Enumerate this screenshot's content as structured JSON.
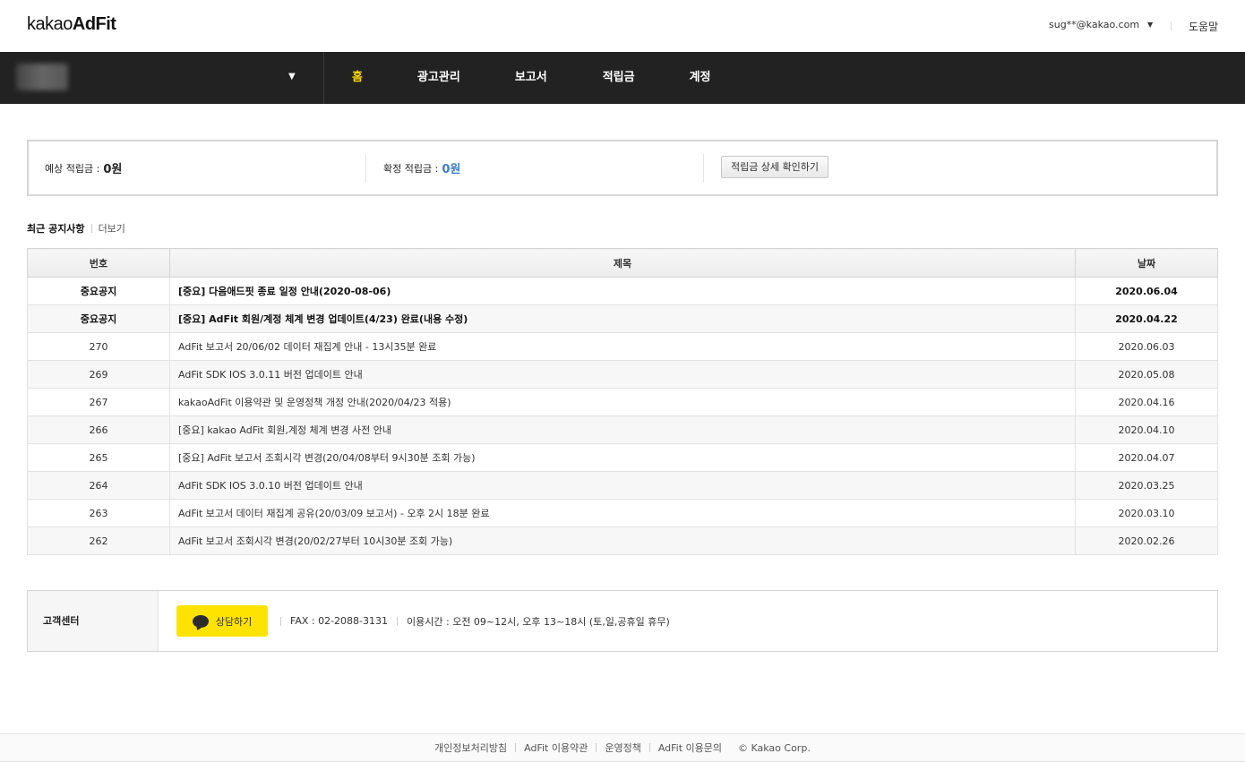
{
  "header": {
    "logo_light": "kakao",
    "logo_bold": "AdFit",
    "user_email": "sug**@kakao.com",
    "help": "도움말"
  },
  "nav": {
    "items": [
      {
        "label": "홈",
        "active": true
      },
      {
        "label": "광고관리",
        "active": false
      },
      {
        "label": "보고서",
        "active": false
      },
      {
        "label": "적립금",
        "active": false
      },
      {
        "label": "계정",
        "active": false
      }
    ]
  },
  "revenue": {
    "expected_label": "예상 적립금 :",
    "expected_value": "0원",
    "confirmed_label": "확정 적립금 :",
    "confirmed_value": "0원",
    "detail_button": "적립금 상세 확인하기"
  },
  "notices": {
    "title": "최근 공지사항",
    "more": "더보기",
    "columns": [
      "번호",
      "제목",
      "날짜"
    ],
    "rows": [
      {
        "num": "중요공지",
        "subject": "[중요] 다음애드핏 종료 일정 안내(2020-08-06)",
        "date": "2020.06.04",
        "important": true
      },
      {
        "num": "중요공지",
        "subject": "[중요] AdFit 회원/계정 체계 변경 업데이트(4/23) 완료(내용 수정)",
        "date": "2020.04.22",
        "important": true
      },
      {
        "num": "270",
        "subject": "AdFit 보고서 20/06/02 데이터 재집계 안내 - 13시35분 완료",
        "date": "2020.06.03",
        "important": false
      },
      {
        "num": "269",
        "subject": "AdFit SDK IOS 3.0.11 버전 업데이트 안내",
        "date": "2020.05.08",
        "important": false
      },
      {
        "num": "267",
        "subject": "kakaoAdFit 이용약관 및 운영정책 개정 안내(2020/04/23 적용)",
        "date": "2020.04.16",
        "important": false
      },
      {
        "num": "266",
        "subject": "[중요] kakao AdFit 회원,계정 체계 변경 사전 안내",
        "date": "2020.04.10",
        "important": false
      },
      {
        "num": "265",
        "subject": "[중요] AdFit 보고서 조회시각 변경(20/04/08부터 9시30분 조회 가능)",
        "date": "2020.04.07",
        "important": false
      },
      {
        "num": "264",
        "subject": "AdFit SDK IOS 3.0.10 버전 업데이트 안내",
        "date": "2020.03.25",
        "important": false
      },
      {
        "num": "263",
        "subject": "AdFit 보고서 데이터 재집계 공유(20/03/09 보고서) - 오후 2시 18분 완료",
        "date": "2020.03.10",
        "important": false
      },
      {
        "num": "262",
        "subject": "AdFit 보고서 조회시각 변경(20/02/27부터 10시30분 조회 가능)",
        "date": "2020.02.26",
        "important": false
      }
    ]
  },
  "customer_center": {
    "label": "고객센터",
    "chat_button": "상담하기",
    "fax": "FAX : 02-2088-3131",
    "hours": "이용시간 : 오전 09~12시, 오후 13~18시 (토,일,공휴일 휴무)"
  },
  "footer": {
    "links": [
      "개인정보처리방침",
      "AdFit 이용약관",
      "운영정책",
      "AdFit 이용문의"
    ],
    "copyright": "© Kakao Corp."
  },
  "colors": {
    "nav_bg": "#222222",
    "active_menu": "#ffd800",
    "chat_button": "#ffe300",
    "confirmed_value": "#3c7dc9"
  }
}
